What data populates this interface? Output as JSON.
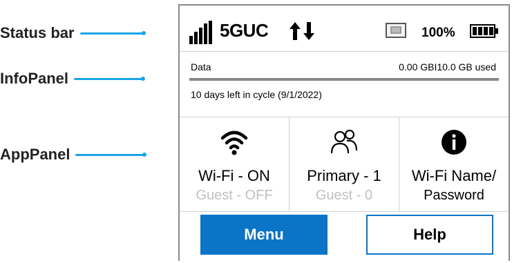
{
  "callouts": {
    "status_bar": "Status bar",
    "info_panel": "InfoPanel",
    "app_panel": "AppPanel"
  },
  "status": {
    "network": "5GUC",
    "battery_percent": "100%",
    "signal_icon": "signal-bars-icon",
    "transfer_icon": "up-down-arrows-icon",
    "sim_icon": "sim-card-icon",
    "battery_icon": "battery-full-icon"
  },
  "info": {
    "data_label": "Data",
    "data_used": "0.00 GBI10.0 GB used",
    "usage_fraction": 0.0,
    "cycle_text": "10 days left in cycle (9/1/2022)"
  },
  "apps": [
    {
      "icon": "wifi-icon",
      "main": "Wi-Fi - ON",
      "sub": "Guest - OFF"
    },
    {
      "icon": "users-icon",
      "main": "Primary - 1",
      "sub": "Guest - 0"
    },
    {
      "icon": "info-icon",
      "main": "Wi-Fi Name/",
      "sub": "Password"
    }
  ],
  "buttons": {
    "menu": "Menu",
    "help": "Help"
  },
  "colors": {
    "accent": "#0a74c6",
    "callout_line": "#1aa3e8",
    "disabled_text": "#c0c0c0"
  }
}
